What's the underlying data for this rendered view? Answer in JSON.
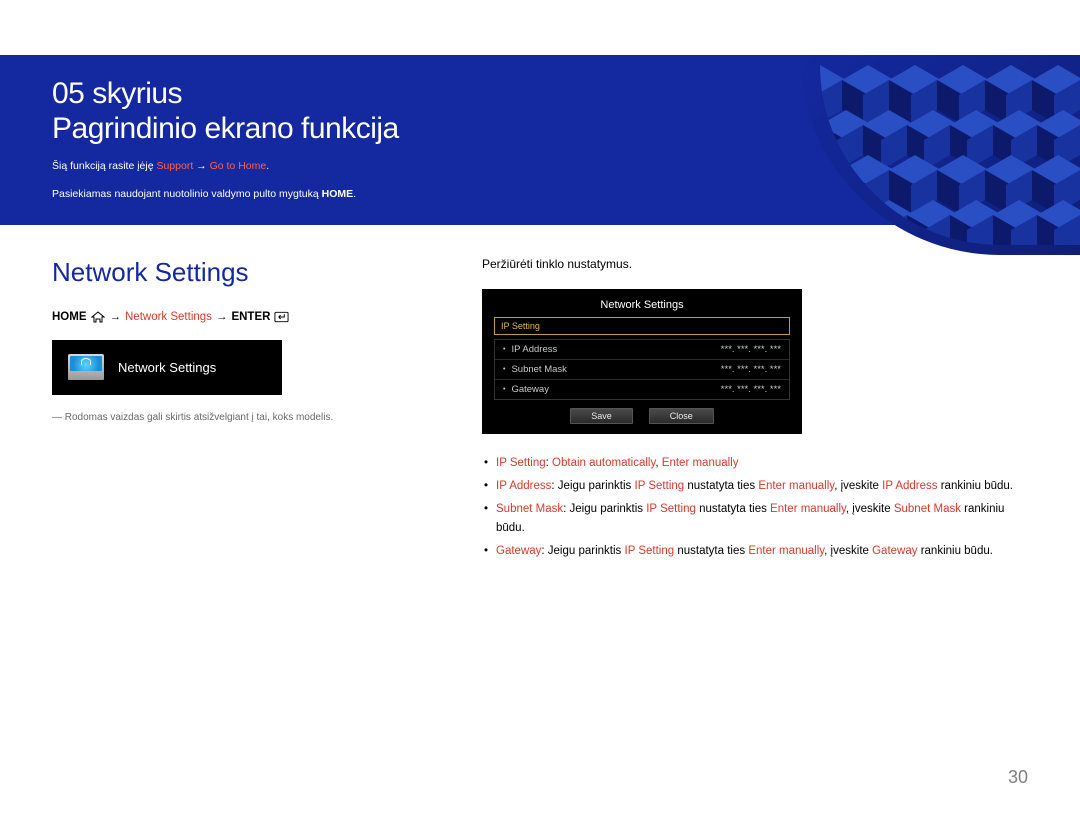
{
  "banner": {
    "chapter_label": "05 skyrius",
    "chapter_title": "Pagrindinio ekrano funkcija",
    "intro_prefix": "Šią funkciją rasite įėję ",
    "intro_red1": "Support",
    "intro_arrow": " → ",
    "intro_red2": "Go to Home",
    "intro_suffix": ".",
    "intro_line2_prefix": "Pasiekiamas naudojant nuotolinio valdymo pulto mygtuką ",
    "intro_line2_bold": "HOME",
    "intro_line2_suffix": "."
  },
  "left": {
    "section_heading": "Network Settings",
    "breadcrumb_home": "HOME",
    "breadcrumb_arrow1": "→",
    "breadcrumb_link": "Network Settings",
    "breadcrumb_arrow2": "→",
    "breadcrumb_enter": "ENTER",
    "widget_label": "Network Settings",
    "note": "― Rodomas vaizdas gali skirtis atsižvelgiant į tai, koks modelis."
  },
  "right": {
    "desc": "Peržiūrėti tinklo nustatymus.",
    "dialog": {
      "title": "Network Settings",
      "highlight": "IP Setting",
      "rows": [
        {
          "label": "IP Address",
          "value": "***. ***. ***. ***"
        },
        {
          "label": "Subnet Mask",
          "value": "***. ***. ***. ***"
        },
        {
          "label": "Gateway",
          "value": "***. ***. ***. ***"
        }
      ],
      "btn_save": "Save",
      "btn_close": "Close"
    },
    "bullets": {
      "b1": {
        "r1": "IP Setting",
        "t1": ": ",
        "r2": "Obtain automatically",
        "t2": ", ",
        "r3": "Enter manually"
      },
      "b2": {
        "r1": "IP Address",
        "t1": ": Jeigu parinktis ",
        "r2": "IP Setting",
        "t2": " nustatyta ties ",
        "r3": "Enter manually",
        "t3": ", įveskite ",
        "r4": "IP Address",
        "t4": " rankiniu būdu."
      },
      "b3": {
        "r1": "Subnet Mask",
        "t1": ": Jeigu parinktis ",
        "r2": "IP Setting",
        "t2": " nustatyta ties ",
        "r3": "Enter manually",
        "t3": ", įveskite ",
        "r4": "Subnet Mask",
        "t4": " rankiniu būdu."
      },
      "b4": {
        "r1": "Gateway",
        "t1": ": Jeigu parinktis ",
        "r2": "IP Setting",
        "t2": " nustatyta ties ",
        "r3": "Enter manually",
        "t3": ", įveskite ",
        "r4": "Gateway",
        "t4": " rankiniu būdu."
      }
    }
  },
  "page_number": "30"
}
